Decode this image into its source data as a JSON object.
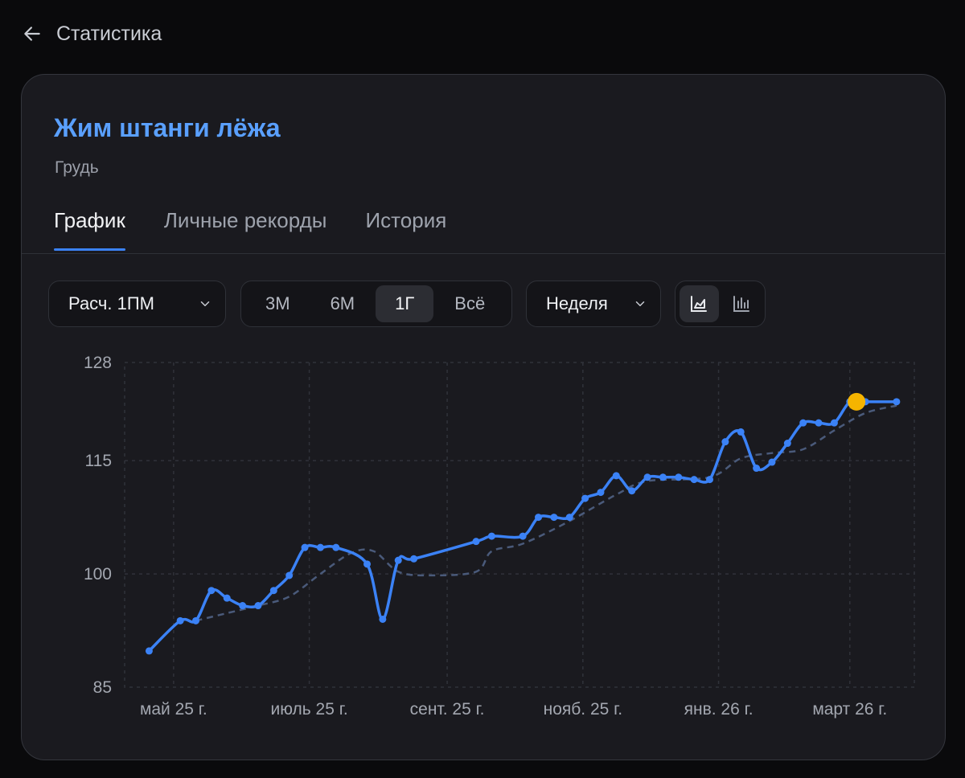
{
  "topbar": {
    "title": "Статистика"
  },
  "exercise": {
    "title": "Жим штанги лёжа",
    "muscle": "Грудь"
  },
  "tabs": [
    {
      "label": "График",
      "active": true
    },
    {
      "label": "Личные рекорды",
      "active": false
    },
    {
      "label": "История",
      "active": false
    }
  ],
  "controls": {
    "metric": "Расч. 1ПМ",
    "ranges": [
      {
        "label": "3М",
        "active": false
      },
      {
        "label": "6М",
        "active": false
      },
      {
        "label": "1Г",
        "active": true
      },
      {
        "label": "Всё",
        "active": false
      }
    ],
    "grouping": "Неделя",
    "view_modes": [
      {
        "icon": "area-chart-icon",
        "active": true
      },
      {
        "icon": "bar-chart-icon",
        "active": false
      }
    ]
  },
  "colors": {
    "accent": "#3b82f6",
    "trend": "#4a5a7a",
    "highlight": "#f5b400",
    "title": "#5aa0ff"
  },
  "chart_data": {
    "type": "line",
    "ylim": [
      85,
      128
    ],
    "yticks": [
      128,
      115,
      100,
      85
    ],
    "xlim": [
      "2025-04-09",
      "2026-03-30"
    ],
    "x_tick_labels": [
      {
        "date": "2025-05-01",
        "label": "май 25 г."
      },
      {
        "date": "2025-07-01",
        "label": "июль 25 г."
      },
      {
        "date": "2025-09-01",
        "label": "сент. 25 г."
      },
      {
        "date": "2025-11-01",
        "label": "нояб. 25 г."
      },
      {
        "date": "2026-01-01",
        "label": "янв. 26 г."
      },
      {
        "date": "2026-03-01",
        "label": "март 26 г."
      }
    ],
    "series": [
      {
        "role": "estimated-1rm",
        "style": "solid",
        "points": [
          [
            "2025-04-20",
            89.8
          ],
          [
            "2025-05-04",
            93.8
          ],
          [
            "2025-05-11",
            93.8
          ],
          [
            "2025-05-18",
            97.8
          ],
          [
            "2025-05-25",
            96.8
          ],
          [
            "2025-06-01",
            95.8
          ],
          [
            "2025-06-08",
            95.8
          ],
          [
            "2025-06-15",
            97.8
          ],
          [
            "2025-06-22",
            99.8
          ],
          [
            "2025-06-29",
            103.5
          ],
          [
            "2025-07-06",
            103.5
          ],
          [
            "2025-07-13",
            103.5
          ],
          [
            "2025-07-27",
            101.3
          ],
          [
            "2025-08-03",
            94.0
          ],
          [
            "2025-08-10",
            101.8
          ],
          [
            "2025-08-17",
            102.0
          ],
          [
            "2025-09-14",
            104.3
          ],
          [
            "2025-09-21",
            105.0
          ],
          [
            "2025-10-05",
            105.0
          ],
          [
            "2025-10-12",
            107.5
          ],
          [
            "2025-10-19",
            107.5
          ],
          [
            "2025-10-26",
            107.5
          ],
          [
            "2025-11-02",
            110.0
          ],
          [
            "2025-11-09",
            110.8
          ],
          [
            "2025-11-16",
            113.0
          ],
          [
            "2025-11-23",
            111.0
          ],
          [
            "2025-11-30",
            112.8
          ],
          [
            "2025-12-07",
            112.8
          ],
          [
            "2025-12-14",
            112.8
          ],
          [
            "2025-12-21",
            112.5
          ],
          [
            "2025-12-28",
            112.5
          ],
          [
            "2026-01-04",
            117.5
          ],
          [
            "2026-01-11",
            118.8
          ],
          [
            "2026-01-18",
            114.0
          ],
          [
            "2026-01-25",
            114.8
          ],
          [
            "2026-02-01",
            117.3
          ],
          [
            "2026-02-08",
            120.0
          ],
          [
            "2026-02-15",
            120.0
          ],
          [
            "2026-02-22",
            120.0
          ],
          [
            "2026-03-01",
            122.8
          ],
          [
            "2026-03-08",
            122.8
          ],
          [
            "2026-03-22",
            122.8
          ]
        ],
        "highlight_point": [
          "2026-03-04",
          122.8
        ]
      },
      {
        "role": "trend",
        "style": "dashed",
        "points": [
          [
            "2025-05-11",
            93.8
          ],
          [
            "2025-05-25",
            94.8
          ],
          [
            "2025-06-08",
            95.8
          ],
          [
            "2025-06-22",
            97.0
          ],
          [
            "2025-07-06",
            100.0
          ],
          [
            "2025-07-20",
            102.8
          ],
          [
            "2025-07-30",
            103.0
          ],
          [
            "2025-08-10",
            100.3
          ],
          [
            "2025-08-24",
            99.8
          ],
          [
            "2025-09-14",
            100.3
          ],
          [
            "2025-09-21",
            103.0
          ],
          [
            "2025-10-05",
            104.0
          ],
          [
            "2025-10-26",
            107.0
          ],
          [
            "2025-11-16",
            110.5
          ],
          [
            "2025-11-30",
            112.3
          ],
          [
            "2025-12-28",
            112.8
          ],
          [
            "2026-01-11",
            115.3
          ],
          [
            "2026-01-25",
            116.0
          ],
          [
            "2026-02-08",
            116.5
          ],
          [
            "2026-02-22",
            119.0
          ],
          [
            "2026-03-08",
            121.3
          ],
          [
            "2026-03-22",
            122.3
          ]
        ]
      }
    ]
  }
}
